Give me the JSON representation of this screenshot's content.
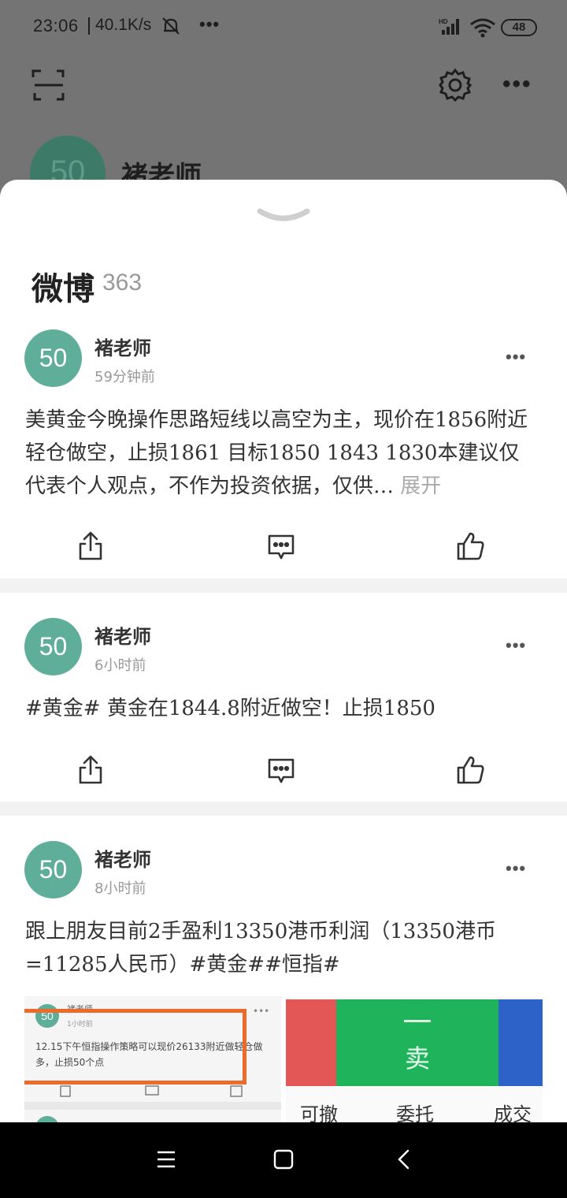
{
  "status_bar": {
    "time": "23:06",
    "net_speed": "40.1K/s",
    "more_dots": "•••",
    "signal_label": "HD",
    "battery": "48",
    "icons": [
      "mute-icon",
      "signal-icon",
      "wifi-icon",
      "battery-icon"
    ]
  },
  "background_page": {
    "avatar_text": "50",
    "name": "褚老师",
    "icons": [
      "scan-icon",
      "gear-icon",
      "more-icon"
    ],
    "more": "•••"
  },
  "sheet": {
    "title": "微博",
    "count": "363"
  },
  "posts": [
    {
      "avatar_text": "50",
      "author": "褚老师",
      "time": "59分钟前",
      "more": "•••",
      "text": "美黄金今晚操作思路短线以高空为主，现价在1856附近轻仓做空，止损1861 目标1850 1843 1830本建议仅代表个人观点，不作为投资依据，仅供…",
      "expand": "展开"
    },
    {
      "avatar_text": "50",
      "author": "褚老师",
      "time": "6小时前",
      "more": "•••",
      "text": "#黄金# 黄金在1844.8附近做空！止损1850"
    },
    {
      "avatar_text": "50",
      "author": "褚老师",
      "time": "8小时前",
      "more": "•••",
      "text": "跟上朋友目前2手盈利13350港币利润（13350港币=11285人民币）#黄金##恒指#",
      "image_left": {
        "avatar_text": "50",
        "name": "褚老师",
        "time": "1小时前",
        "dots": "•••",
        "text": "12.15下午恒指操作策略可以现价26133附近做轻仓做多，止损50个点"
      },
      "image_right": {
        "dash": "一",
        "sell": "卖",
        "tabs": [
          "可撤",
          "委托",
          "成交"
        ]
      }
    }
  ],
  "action_icons": [
    "share-icon",
    "comment-icon",
    "like-icon"
  ],
  "nav_bar": [
    "menu-icon",
    "home-icon",
    "back-icon"
  ],
  "colors": {
    "avatar": "#5fae99",
    "sheet_bg": "#ffffff",
    "divider": "#f2f2f2",
    "highlight_box": "#ec6a2a",
    "sell_green": "#1fb35c"
  }
}
